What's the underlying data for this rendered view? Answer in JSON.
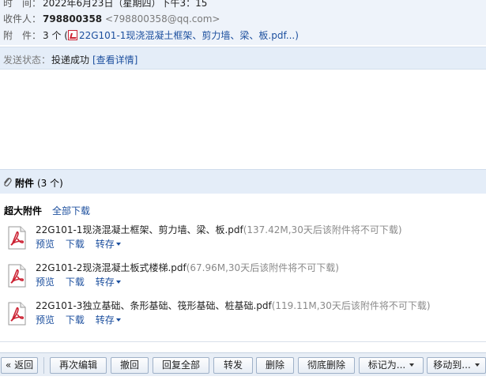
{
  "header": {
    "time_label": "时　间：",
    "time_value": "2022年6月23日（星期四）下午3：15",
    "recipient_label": "收件人：",
    "recipient_name": "798800358",
    "recipient_email": "<798800358@qq.com>",
    "attachment_label": "附　件：",
    "attachment_count": "3 个",
    "attachment_open": "(",
    "attachment_link": "22G101-1现浇混凝土框架、剪力墙、梁、板.pdf...",
    "attachment_close": ")"
  },
  "status": {
    "label": "发送状态：",
    "value": "投递成功",
    "details_link": "[查看详情]"
  },
  "attachments": {
    "title": "附件",
    "count": "(3 个)",
    "super_label": "超大附件",
    "download_all": "全部下载",
    "actions": {
      "preview": "预览",
      "download": "下载",
      "save": "转存"
    },
    "files": [
      {
        "name": "22G101-1现浇混凝土框架、剪力墙、梁、板.pdf",
        "meta": "(137.42M,30天后该附件将不可下载)"
      },
      {
        "name": "22G101-2现浇混凝土板式楼梯.pdf",
        "meta": "(67.96M,30天后该附件将不可下载)"
      },
      {
        "name": "22G101-3独立基础、条形基础、筏形基础、桩基础.pdf",
        "meta": "(119.11M,30天后该附件将不可下载)"
      }
    ]
  },
  "toolbar": {
    "back": "« 返回",
    "re_edit": "再次编辑",
    "recall": "撤回",
    "reply_all": "回复全部",
    "forward": "转发",
    "delete": "删除",
    "delete_permanent": "彻底删除",
    "mark_as": "标记为...",
    "move_to": "移动到..."
  },
  "colors": {
    "link": "#1c4f9e",
    "header_bg": "#eef3fa",
    "bar_bg": "#e4edf8",
    "pdf_red": "#cc2233"
  }
}
